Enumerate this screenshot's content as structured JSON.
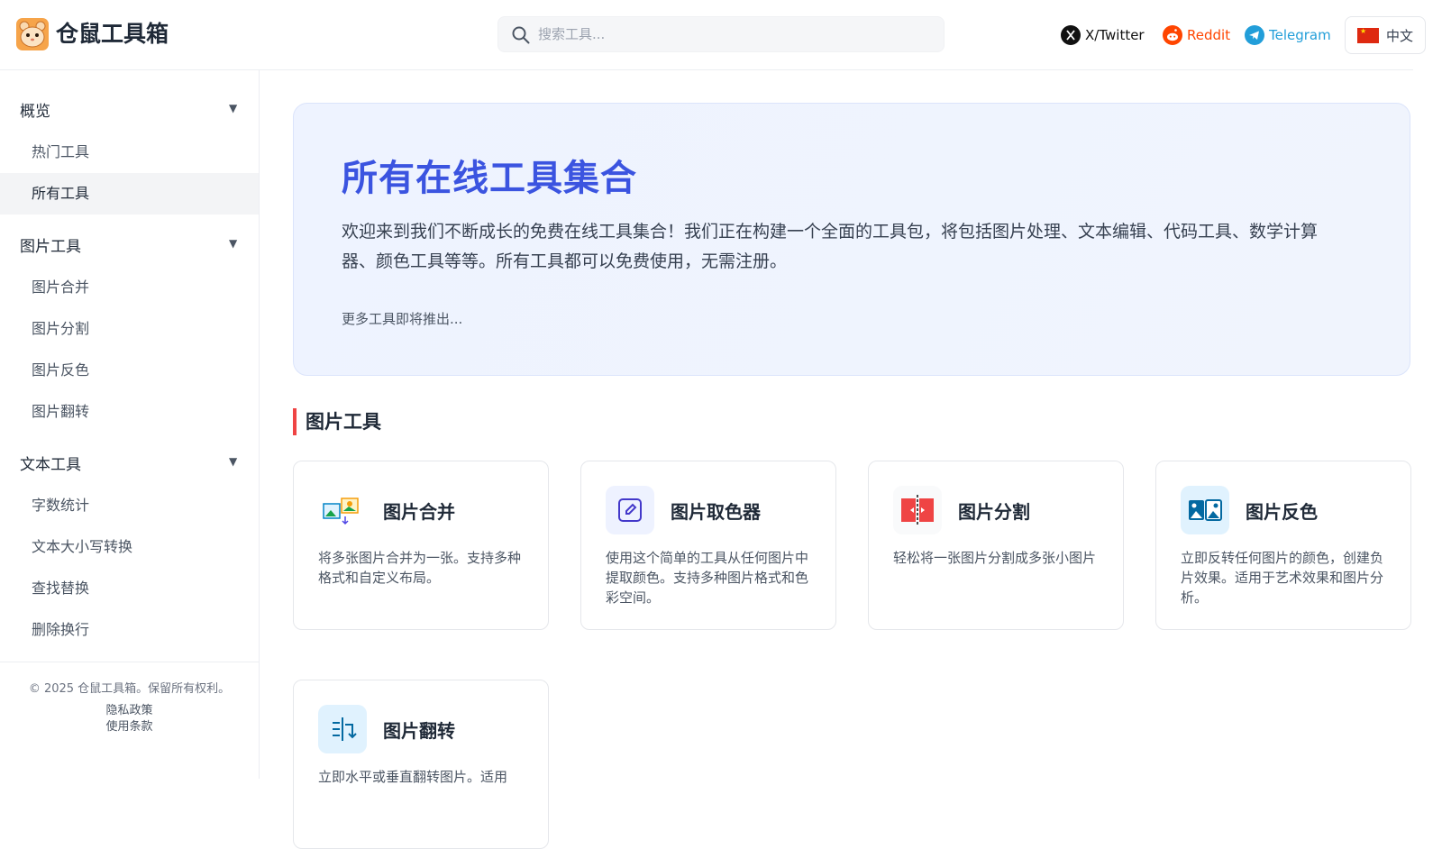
{
  "header": {
    "brand": "仓鼠工具箱",
    "search_placeholder": "搜索工具...",
    "socials": [
      {
        "label": "X/Twitter",
        "color": "#111111"
      },
      {
        "label": "Reddit",
        "color": "#ff4500"
      },
      {
        "label": "Telegram",
        "color": "#229ed9"
      }
    ],
    "language": "中文"
  },
  "sidebar": {
    "groups": [
      {
        "label": "概览",
        "items": [
          "热门工具",
          "所有工具"
        ]
      },
      {
        "label": "图片工具",
        "items": [
          "图片合并",
          "图片分割",
          "图片反色",
          "图片翻转"
        ]
      },
      {
        "label": "文本工具",
        "items": [
          "字数统计",
          "文本大小写转换",
          "查找替换",
          "删除换行"
        ]
      }
    ],
    "active_item": "所有工具",
    "footer": {
      "copyright": "© 2025 仓鼠工具箱。保留所有权利。",
      "links": [
        "隐私政策",
        "使用条款"
      ]
    }
  },
  "hero": {
    "title": "所有在线工具集合",
    "description": "欢迎来到我们不断成长的免费在线工具集合！我们正在构建一个全面的工具包，将包括图片处理、文本编辑、代码工具、数学计算器、颜色工具等等。所有工具都可以免费使用，无需注册。",
    "more": "更多工具即将推出..."
  },
  "section": {
    "title": "图片工具",
    "accent": "#ef4444"
  },
  "tools": [
    {
      "title": "图片合并",
      "desc": "将多张图片合并为一张。支持多种格式和自定义布局。",
      "icon": "image-merge-icon"
    },
    {
      "title": "图片取色器",
      "desc": "使用这个简单的工具从任何图片中提取颜色。支持多种图片格式和色彩空间。",
      "icon": "color-picker-icon"
    },
    {
      "title": "图片分割",
      "desc": "轻松将一张图片分割成多张小图片",
      "icon": "image-split-icon"
    },
    {
      "title": "图片反色",
      "desc": "立即反转任何图片的颜色，创建负片效果。适用于艺术效果和图片分析。",
      "icon": "image-invert-icon"
    },
    {
      "title": "图片翻转",
      "desc": "立即水平或垂直翻转图片。适用",
      "icon": "image-flip-icon"
    }
  ]
}
